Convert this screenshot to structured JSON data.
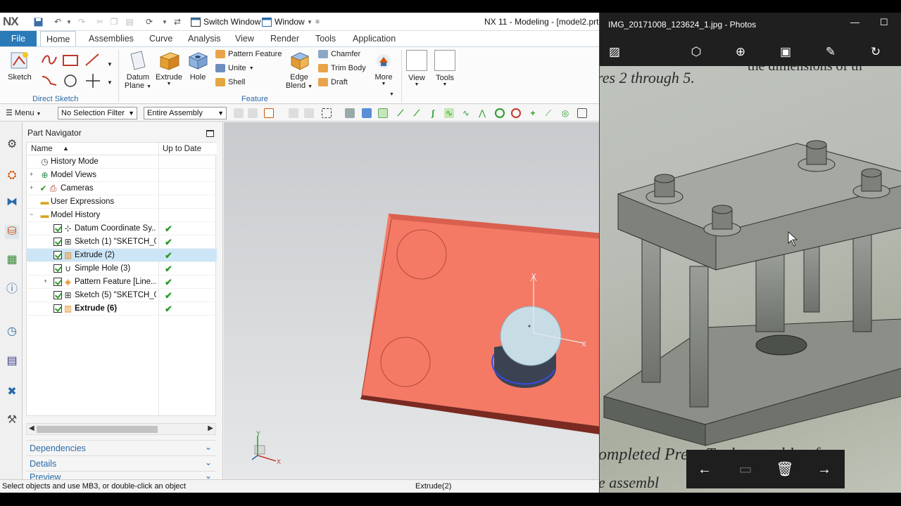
{
  "nx": {
    "logo": "NX",
    "switch_window": "Switch Window",
    "window_menu": "Window",
    "title": "NX 11 - Modeling - [model2.prt (",
    "tabs": [
      "File",
      "Home",
      "Assemblies",
      "Curve",
      "Analysis",
      "View",
      "Render",
      "Tools",
      "Application"
    ],
    "active_tab": "Home",
    "ribbon": {
      "sketch": "Sketch",
      "direct_sketch_group": "Direct Sketch",
      "datum_plane_1": "Datum",
      "datum_plane_2": "Plane",
      "extrude": "Extrude",
      "hole": "Hole",
      "pattern_feature": "Pattern Feature",
      "unite": "Unite",
      "shell": "Shell",
      "feature_group": "Feature",
      "edge_blend_1": "Edge",
      "edge_blend_2": "Blend",
      "chamfer": "Chamfer",
      "trim_body": "Trim Body",
      "draft": "Draft",
      "more": "More",
      "view": "View",
      "tools": "Tools"
    },
    "selbar": {
      "menu": "Menu",
      "selection_filter": "No Selection Filter",
      "assembly_scope": "Entire Assembly"
    },
    "navigator": {
      "title": "Part Navigator",
      "col_name": "Name",
      "col_uptodate": "Up to Date",
      "rows": [
        {
          "label": "History Mode"
        },
        {
          "label": "Model Views"
        },
        {
          "label": "Cameras"
        },
        {
          "label": "User Expressions"
        },
        {
          "label": "Model History"
        },
        {
          "label": "Datum Coordinate Sy..."
        },
        {
          "label": "Sketch (1) \"SKETCH_0..."
        },
        {
          "label": "Extrude (2)"
        },
        {
          "label": "Simple Hole (3)"
        },
        {
          "label": "Pattern Feature [Line..."
        },
        {
          "label": "Sketch (5) \"SKETCH_0..."
        },
        {
          "label": "Extrude (6)"
        }
      ],
      "panels": [
        "Dependencies",
        "Details",
        "Preview"
      ]
    },
    "status_left": "Select objects and use MB3, or double-click an object",
    "status_right": "Extrude(2)",
    "axis_x": "X",
    "axis_y": "Y"
  },
  "photos": {
    "title": "IMG_20171008_123624_1.jpg - Photos",
    "image_text_top": "res 2 through 5.",
    "image_text_top_fragment": "the dimensions of th",
    "image_text_bottom": "ompleted Press Tool assembly of",
    "image_text_bottom2": "e assembl"
  }
}
